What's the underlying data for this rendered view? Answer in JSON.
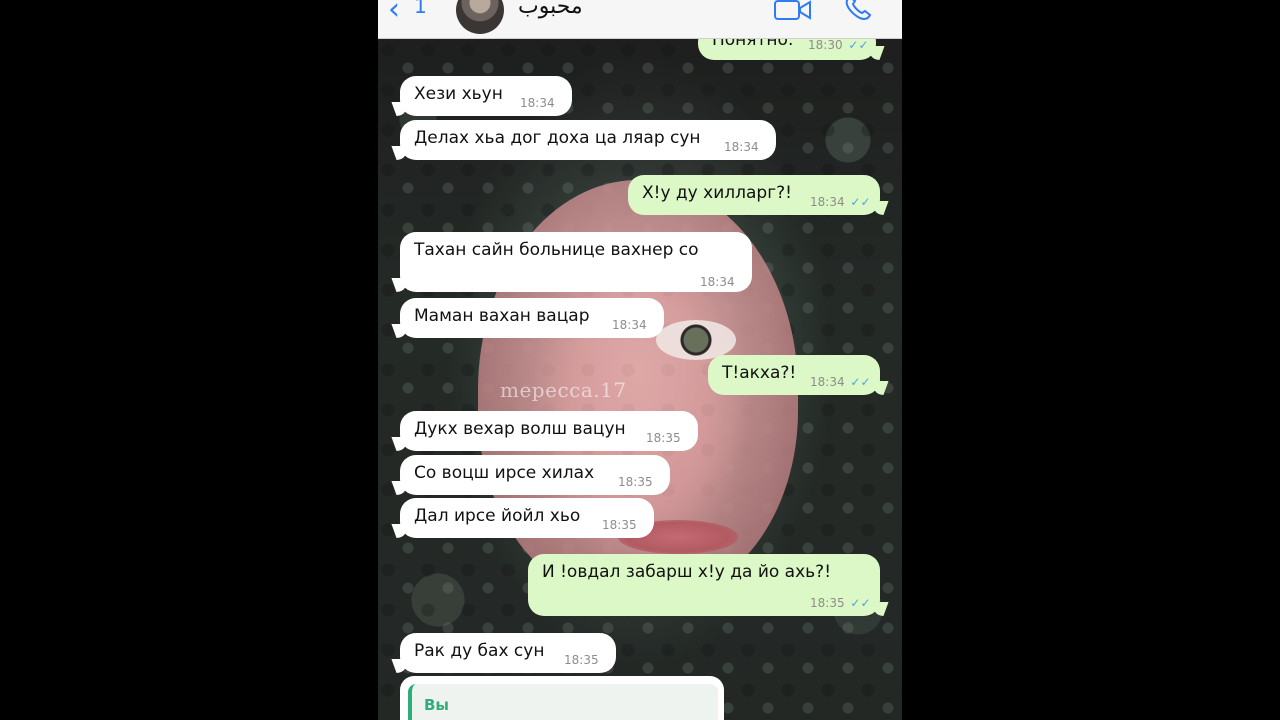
{
  "header": {
    "back_glyph": "‹",
    "back_count": "1",
    "contact_name": "محبوب",
    "icons": [
      "back-arrow-icon",
      "avatar",
      "video-call-icon",
      "phone-call-icon"
    ],
    "accent": "#2f7bf5"
  },
  "wallpaper": {
    "watermark": "mepecca.17"
  },
  "messages": [
    {
      "dir": "out",
      "text": "Понятно.",
      "time": "18:30",
      "ticks": "✓✓"
    },
    {
      "dir": "in",
      "text": "Хези хьун",
      "time": "18:34"
    },
    {
      "dir": "in",
      "text": "Делах хьа дог доха ца ляар сун",
      "time": "18:34"
    },
    {
      "dir": "out",
      "text": "Х!у ду хилларг?!",
      "time": "18:34",
      "ticks": "✓✓"
    },
    {
      "dir": "in",
      "text": "Тахан сайн больнице вахнер со",
      "time": "18:34"
    },
    {
      "dir": "in",
      "text": "Маман вахан вацар",
      "time": "18:34"
    },
    {
      "dir": "out",
      "text": "Т!акха?!",
      "time": "18:34",
      "ticks": "✓✓"
    },
    {
      "dir": "in",
      "text": "Дукх вехар волш вацун",
      "time": "18:35"
    },
    {
      "dir": "in",
      "text": "Со воцш ирсе хилах",
      "time": "18:35"
    },
    {
      "dir": "in",
      "text": "Дал ирсе йойл хьо",
      "time": "18:35"
    },
    {
      "dir": "out",
      "text": "И !овдал забарш х!у да йо ахь?!",
      "time": "18:35",
      "ticks": "✓✓"
    },
    {
      "dir": "in",
      "text": "Рак ду бах сун",
      "time": "18:35"
    }
  ],
  "reply_preview": {
    "label": "Вы"
  },
  "colors": {
    "incoming_bubble": "#ffffff",
    "outgoing_bubble": "#dcf8c6",
    "read_ticks": "#4fa3e3",
    "quote_bar": "#2fae7a"
  }
}
